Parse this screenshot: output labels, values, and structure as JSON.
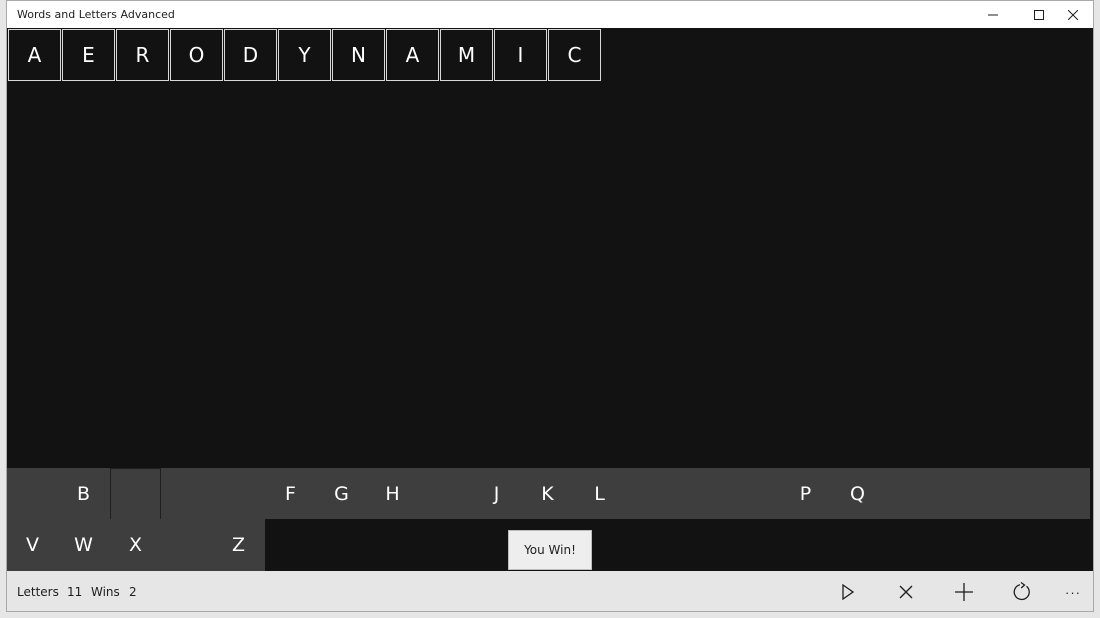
{
  "window": {
    "title": "Words and Letters Advanced"
  },
  "word_tiles": [
    "A",
    "E",
    "R",
    "O",
    "D",
    "Y",
    "N",
    "A",
    "M",
    "I",
    "C"
  ],
  "pool_row1": {
    "B": "B",
    "F": "F",
    "G": "G",
    "H": "H",
    "J": "J",
    "K": "K",
    "L": "L",
    "P": "P",
    "Q": "Q"
  },
  "pool_row2": {
    "V": "V",
    "W": "W",
    "X": "X",
    "Z": "Z"
  },
  "message": "You Win!",
  "stats": {
    "letters_label": "Letters",
    "letters_value": "11",
    "wins_label": "Wins",
    "wins_value": "2"
  },
  "icons": {
    "play": "play-icon",
    "cancel": "close-icon",
    "add": "plus-icon",
    "refresh": "refresh-icon",
    "more": "more-icon"
  },
  "more_label": "···",
  "colors": {
    "board": "#121212",
    "pool": "#3e3e3e",
    "bar": "#e6e6e6"
  }
}
